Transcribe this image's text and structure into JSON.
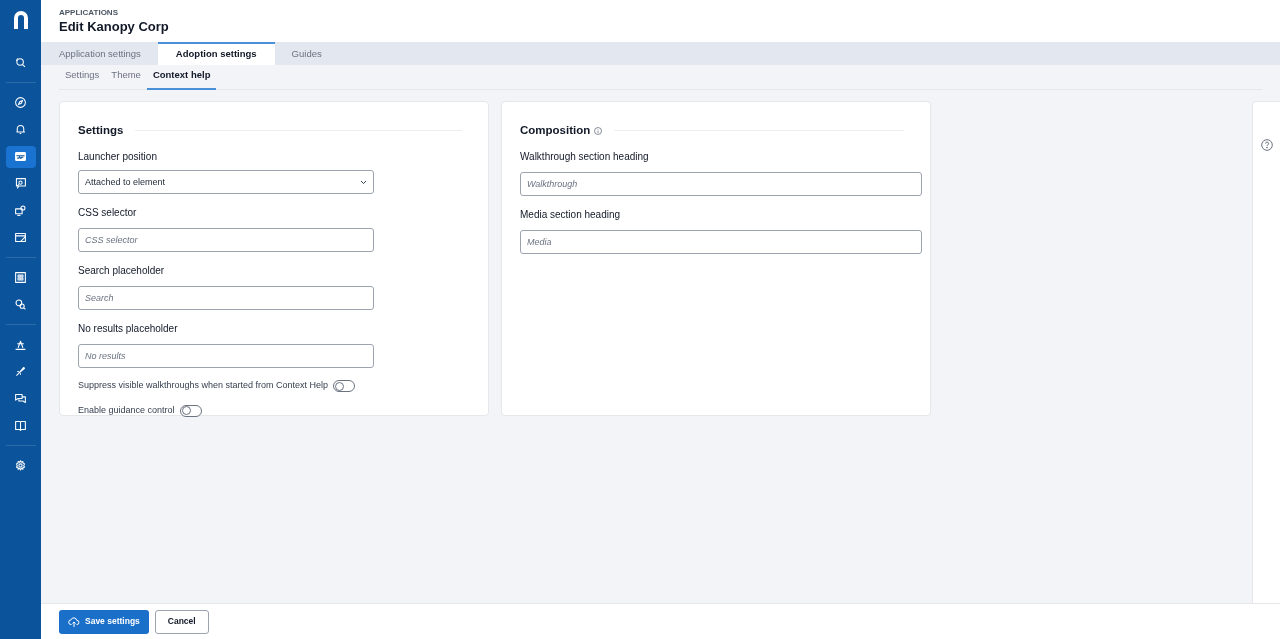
{
  "sidebar": {
    "groups": [
      [
        {
          "selected": false
        }
      ],
      [
        {
          "selected": false
        },
        {
          "selected": false
        },
        {
          "selected": true
        },
        {
          "selected": false
        },
        {
          "selected": false
        },
        {
          "selected": false
        }
      ],
      [
        {
          "selected": false
        },
        {
          "selected": false
        }
      ],
      [
        {
          "selected": false
        },
        {
          "selected": false
        },
        {
          "selected": false
        },
        {
          "selected": false
        }
      ],
      [
        {
          "selected": false
        }
      ]
    ]
  },
  "header": {
    "breadcrumb": "APPLICATIONS",
    "title": "Edit Kanopy Corp"
  },
  "tabs": [
    {
      "label": "Application settings",
      "selected": false
    },
    {
      "label": "Adoption settings",
      "selected": true
    },
    {
      "label": "Guides",
      "selected": false
    }
  ],
  "subtabs": [
    {
      "label": "Settings",
      "selected": false
    },
    {
      "label": "Theme",
      "selected": false
    },
    {
      "label": "Context help",
      "selected": true
    }
  ],
  "panels": [
    {
      "title": "Settings",
      "info": false,
      "fields": [
        {
          "kind": "select",
          "label": "Launcher position",
          "value": "Attached to element"
        },
        {
          "kind": "text",
          "label": "CSS selector",
          "placeholder": "CSS selector"
        },
        {
          "kind": "text",
          "label": "Search placeholder",
          "placeholder": "Search"
        },
        {
          "kind": "text",
          "label": "No results placeholder",
          "placeholder": "No results"
        },
        {
          "kind": "toggle",
          "label": "Suppress visible walkthroughs when started from Context Help",
          "on": false
        },
        {
          "kind": "toggle",
          "label": "Enable guidance control",
          "on": false
        }
      ]
    },
    {
      "title": "Composition",
      "info": true,
      "fields": [
        {
          "kind": "text",
          "label": "Walkthrough section heading",
          "placeholder": "Walkthrough"
        },
        {
          "kind": "text",
          "label": "Media section heading",
          "placeholder": "Media"
        }
      ]
    }
  ],
  "footer": {
    "buttons": [
      {
        "kind": "primary",
        "label": "Save settings"
      },
      {
        "kind": "secondary",
        "label": "Cancel"
      }
    ]
  }
}
